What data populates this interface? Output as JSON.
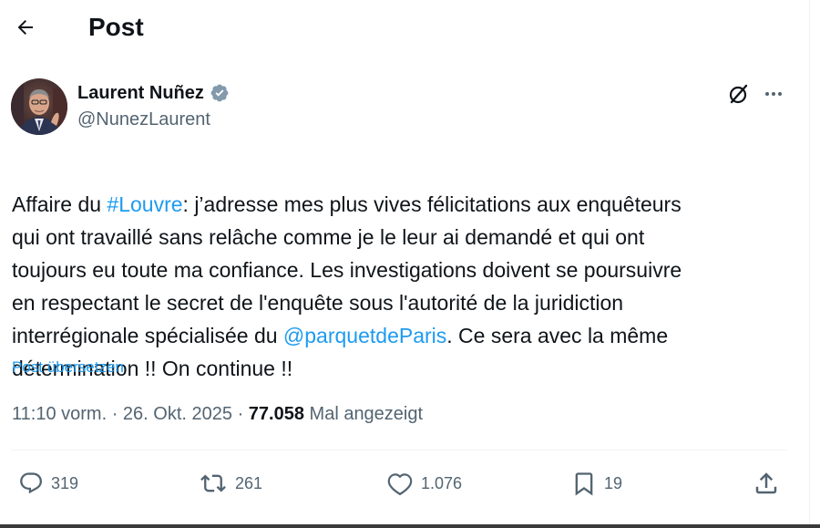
{
  "header": {
    "title": "Post"
  },
  "author": {
    "name": "Laurent Nuñez",
    "handle": "@NunezLaurent"
  },
  "post": {
    "segments": [
      {
        "text": "Affaire du ",
        "type": "text"
      },
      {
        "text": "#Louvre",
        "type": "link"
      },
      {
        "text": ": j’adresse mes plus vives félicitations aux enquêteurs\nqui ont travaillé sans relâche comme je le leur ai demandé et qui ont\ntoujours eu toute ma confiance. Les investigations doivent se poursuivre\nen respectant le secret de l'enquête sous l'autorité de la juridiction\ninterrégionale spécialisée du ",
        "type": "text"
      },
      {
        "text": "@parquetdeParis",
        "type": "link"
      },
      {
        "text": ". Ce sera avec la même\ndétermination !! On continue !!",
        "type": "text"
      }
    ],
    "translate_label": "Post übersetzen",
    "time": "11:10 vorm.",
    "separator": "·",
    "date": "26. Okt. 2025",
    "views_count": "77.058",
    "views_label": "Mal angezeigt"
  },
  "actions": {
    "replies": "319",
    "reposts": "261",
    "likes": "1.076",
    "bookmarks": "19"
  },
  "colors": {
    "accent": "#1d9bf0",
    "text": "#0f1419",
    "secondary": "#536471",
    "verified": "#829aab"
  },
  "icons": {
    "back": "arrow-left-icon",
    "verified": "verified-badge-icon",
    "grok": "grok-icon",
    "more": "more-horizontal-icon",
    "reply": "reply-icon",
    "repost": "repost-icon",
    "like": "heart-icon",
    "bookmark": "bookmark-icon",
    "share": "share-icon"
  }
}
